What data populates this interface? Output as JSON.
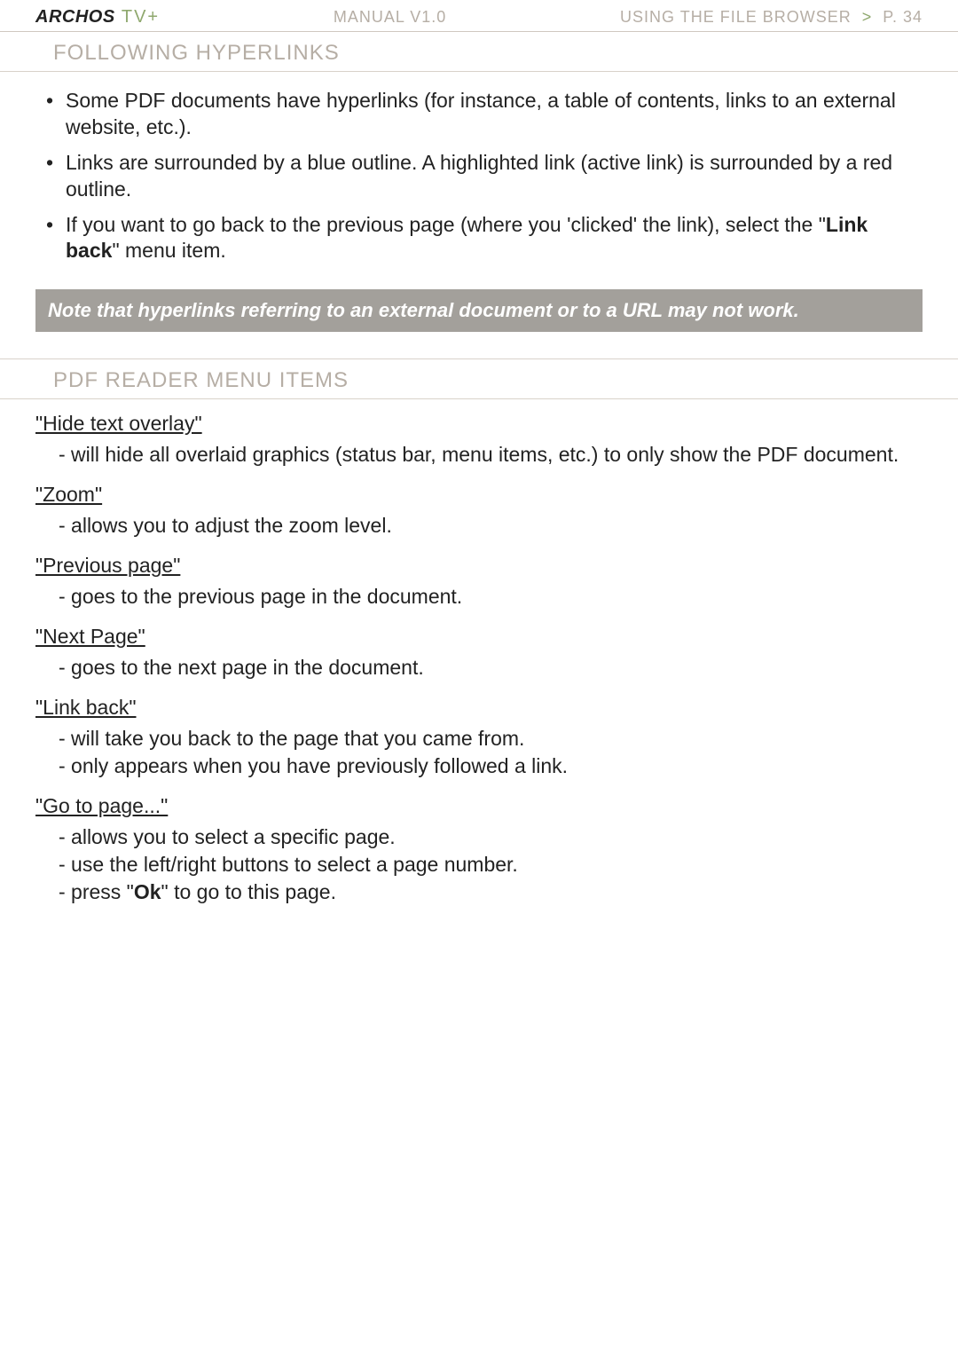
{
  "header": {
    "brand_archos": "ARCHOS",
    "brand_tv": " TV+",
    "manual": "MANUAL V1.0",
    "crumb_section": "USING THE FILE BROWSER",
    "crumb_gt": ">",
    "crumb_page": "P. 34"
  },
  "sections": {
    "hyperlinks_heading": "FOLLOWING HYPERLINKS",
    "bullets": {
      "b1": "Some PDF documents have hyperlinks (for instance, a table of contents, links to an external website, etc.).",
      "b2": "Links are surrounded by a blue outline. A highlighted link (active link) is surrounded by a red outline.",
      "b3_pre": "If you want to go back to the previous page (where you 'clicked' the link), select the \"",
      "b3_bold": "Link back",
      "b3_post": "\" menu item."
    },
    "note": "Note that hyperlinks referring to an external document or to a URL may not work.",
    "menu_heading": "PDF READER MENU ITEMS",
    "items": {
      "hide": {
        "term": "\"Hide text overlay\"",
        "d1": "- will hide all overlaid graphics (status bar, menu items, etc.) to only show the PDF document."
      },
      "zoom": {
        "term": "\"Zoom\"",
        "d1": "- allows you to adjust the zoom level."
      },
      "prev": {
        "term": "\"Previous page\"",
        "d1": "- goes to the previous page in the document."
      },
      "next": {
        "term": "\"Next Page\"",
        "d1": "- goes to the next page in the document."
      },
      "linkback": {
        "term": "\"Link back\"",
        "d1": "- will take you back to the page that you came from.",
        "d2": "- only appears when you have previously followed a link."
      },
      "goto": {
        "term": "\"Go to page...\"",
        "d1": "- allows you to select a specific page.",
        "d2": "- use the left/right buttons to select a page number.",
        "d3_pre": "- press \"",
        "d3_bold": "Ok",
        "d3_post": "\" to go to this page."
      }
    }
  }
}
